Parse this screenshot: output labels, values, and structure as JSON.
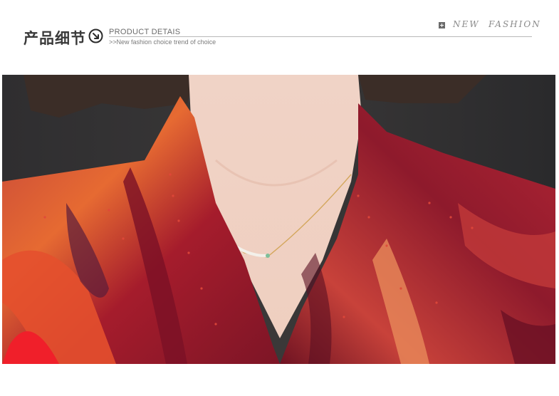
{
  "header": {
    "title_cn": "产品细节",
    "title_en": "PRODUCT DETAIS",
    "subtitle_en": ">>New fashion choice trend of choice",
    "tag_word1": "NEW",
    "tag_word2": "FASHION"
  },
  "photo": {
    "subject": "product-detail-photo"
  },
  "colors": {
    "title": "#3a3a3a",
    "rule": "#b8b8b8",
    "scarf_red": "#a8182a",
    "scarf_orange": "#e2622a"
  }
}
